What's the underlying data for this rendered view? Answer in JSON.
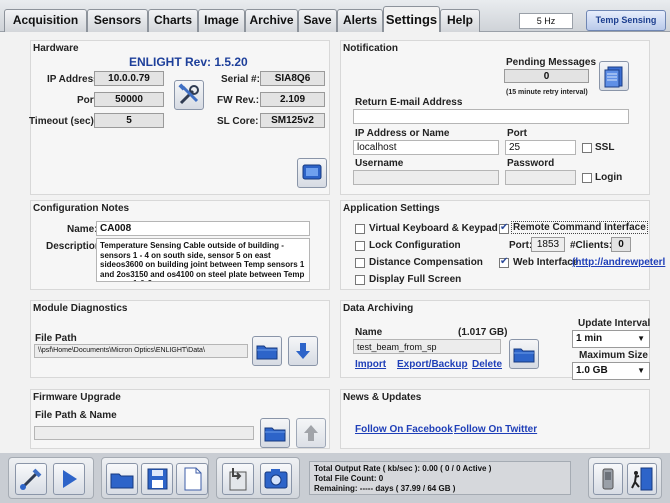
{
  "tabs": [
    {
      "label": "Acquisition"
    },
    {
      "label": "Sensors"
    },
    {
      "label": "Charts"
    },
    {
      "label": "Image"
    },
    {
      "label": "Archive"
    },
    {
      "label": "Save"
    },
    {
      "label": "Alerts"
    },
    {
      "label": "Settings",
      "active": true
    },
    {
      "label": "Help"
    }
  ],
  "rate": "5 Hz",
  "app_mode": "Temp Sensing",
  "hardware": {
    "title": "Hardware",
    "rev": "ENLIGHT Rev: 1.5.20",
    "ip_label": "IP Address:",
    "ip": "10.0.0.79",
    "port_label": "Port:",
    "port": "50000",
    "timeout_label": "Timeout (sec):",
    "timeout": "5",
    "serial_label": "Serial #:",
    "serial": "SIA8Q6",
    "fw_label": "FW Rev.:",
    "fw": "2.109",
    "core_label": "SL Core:",
    "core": "SM125v2"
  },
  "notification": {
    "title": "Notification",
    "pending_label": "Pending Messages",
    "pending": "0",
    "retry": "(15 minute retry interval)",
    "return_email_label": "Return E-mail Address",
    "return_email": "",
    "ip_label": "IP Address or Name",
    "ip": "localhost",
    "port_label": "Port",
    "port": "25",
    "ssl_label": "SSL",
    "username_label": "Username",
    "username": "",
    "password_label": "Password",
    "password": "",
    "login_label": "Login"
  },
  "config": {
    "title": "Configuration Notes",
    "name_label": "Name:",
    "name": "CA008",
    "desc_label": "Description:",
    "desc": "Temperature Sensing Cable outside of building - sensors 1 - 4 on south side, sensor 5 on east sideos3600 on building joint between Temp sensors 1 and 2os3150 and os4100 on steel plate between Temp sensors 1 & 2"
  },
  "app_settings": {
    "title": "Application Settings",
    "virtual_kb": "Virtual Keyboard & Keypad",
    "lock_config": "Lock Configuration",
    "distance_comp": "Distance Compensation",
    "display_full": "Display Full Screen",
    "remote_cmd": "Remote Command Interface",
    "port_label": "Port:",
    "port": "1853",
    "clients_label": "#Clients:",
    "clients": "0",
    "web_label": "Web Interface",
    "web_link": "(http://andrewpeterl"
  },
  "diagnostics": {
    "title": "Module Diagnostics",
    "path_label": "File Path",
    "path": "\\\\psf\\Home\\Documents\\Micron Optics\\ENLIGHT\\Data\\"
  },
  "archiving": {
    "title": "Data Archiving",
    "name_label": "Name",
    "size": "(1.017 GB)",
    "name": "test_beam_from_sp",
    "import": "Import",
    "export": "Export/Backup",
    "delete": "Delete",
    "update_label": "Update Interval",
    "update_value": "1 min",
    "max_label": "Maximum Size",
    "max_value": "1.0 GB"
  },
  "firmware": {
    "title": "Firmware Upgrade",
    "path_label": "File Path & Name",
    "path": ""
  },
  "news": {
    "title": "News & Updates",
    "facebook": "Follow On Facebook",
    "twitter": "Follow On Twitter"
  },
  "status": {
    "line1": "Total Output Rate ( kb/sec ): 0.00 ( 0 / 0 Active )",
    "line2": "Total File Count: 0",
    "line3": "Remaining: ----- days ( 37.99 / 64 GB )"
  }
}
